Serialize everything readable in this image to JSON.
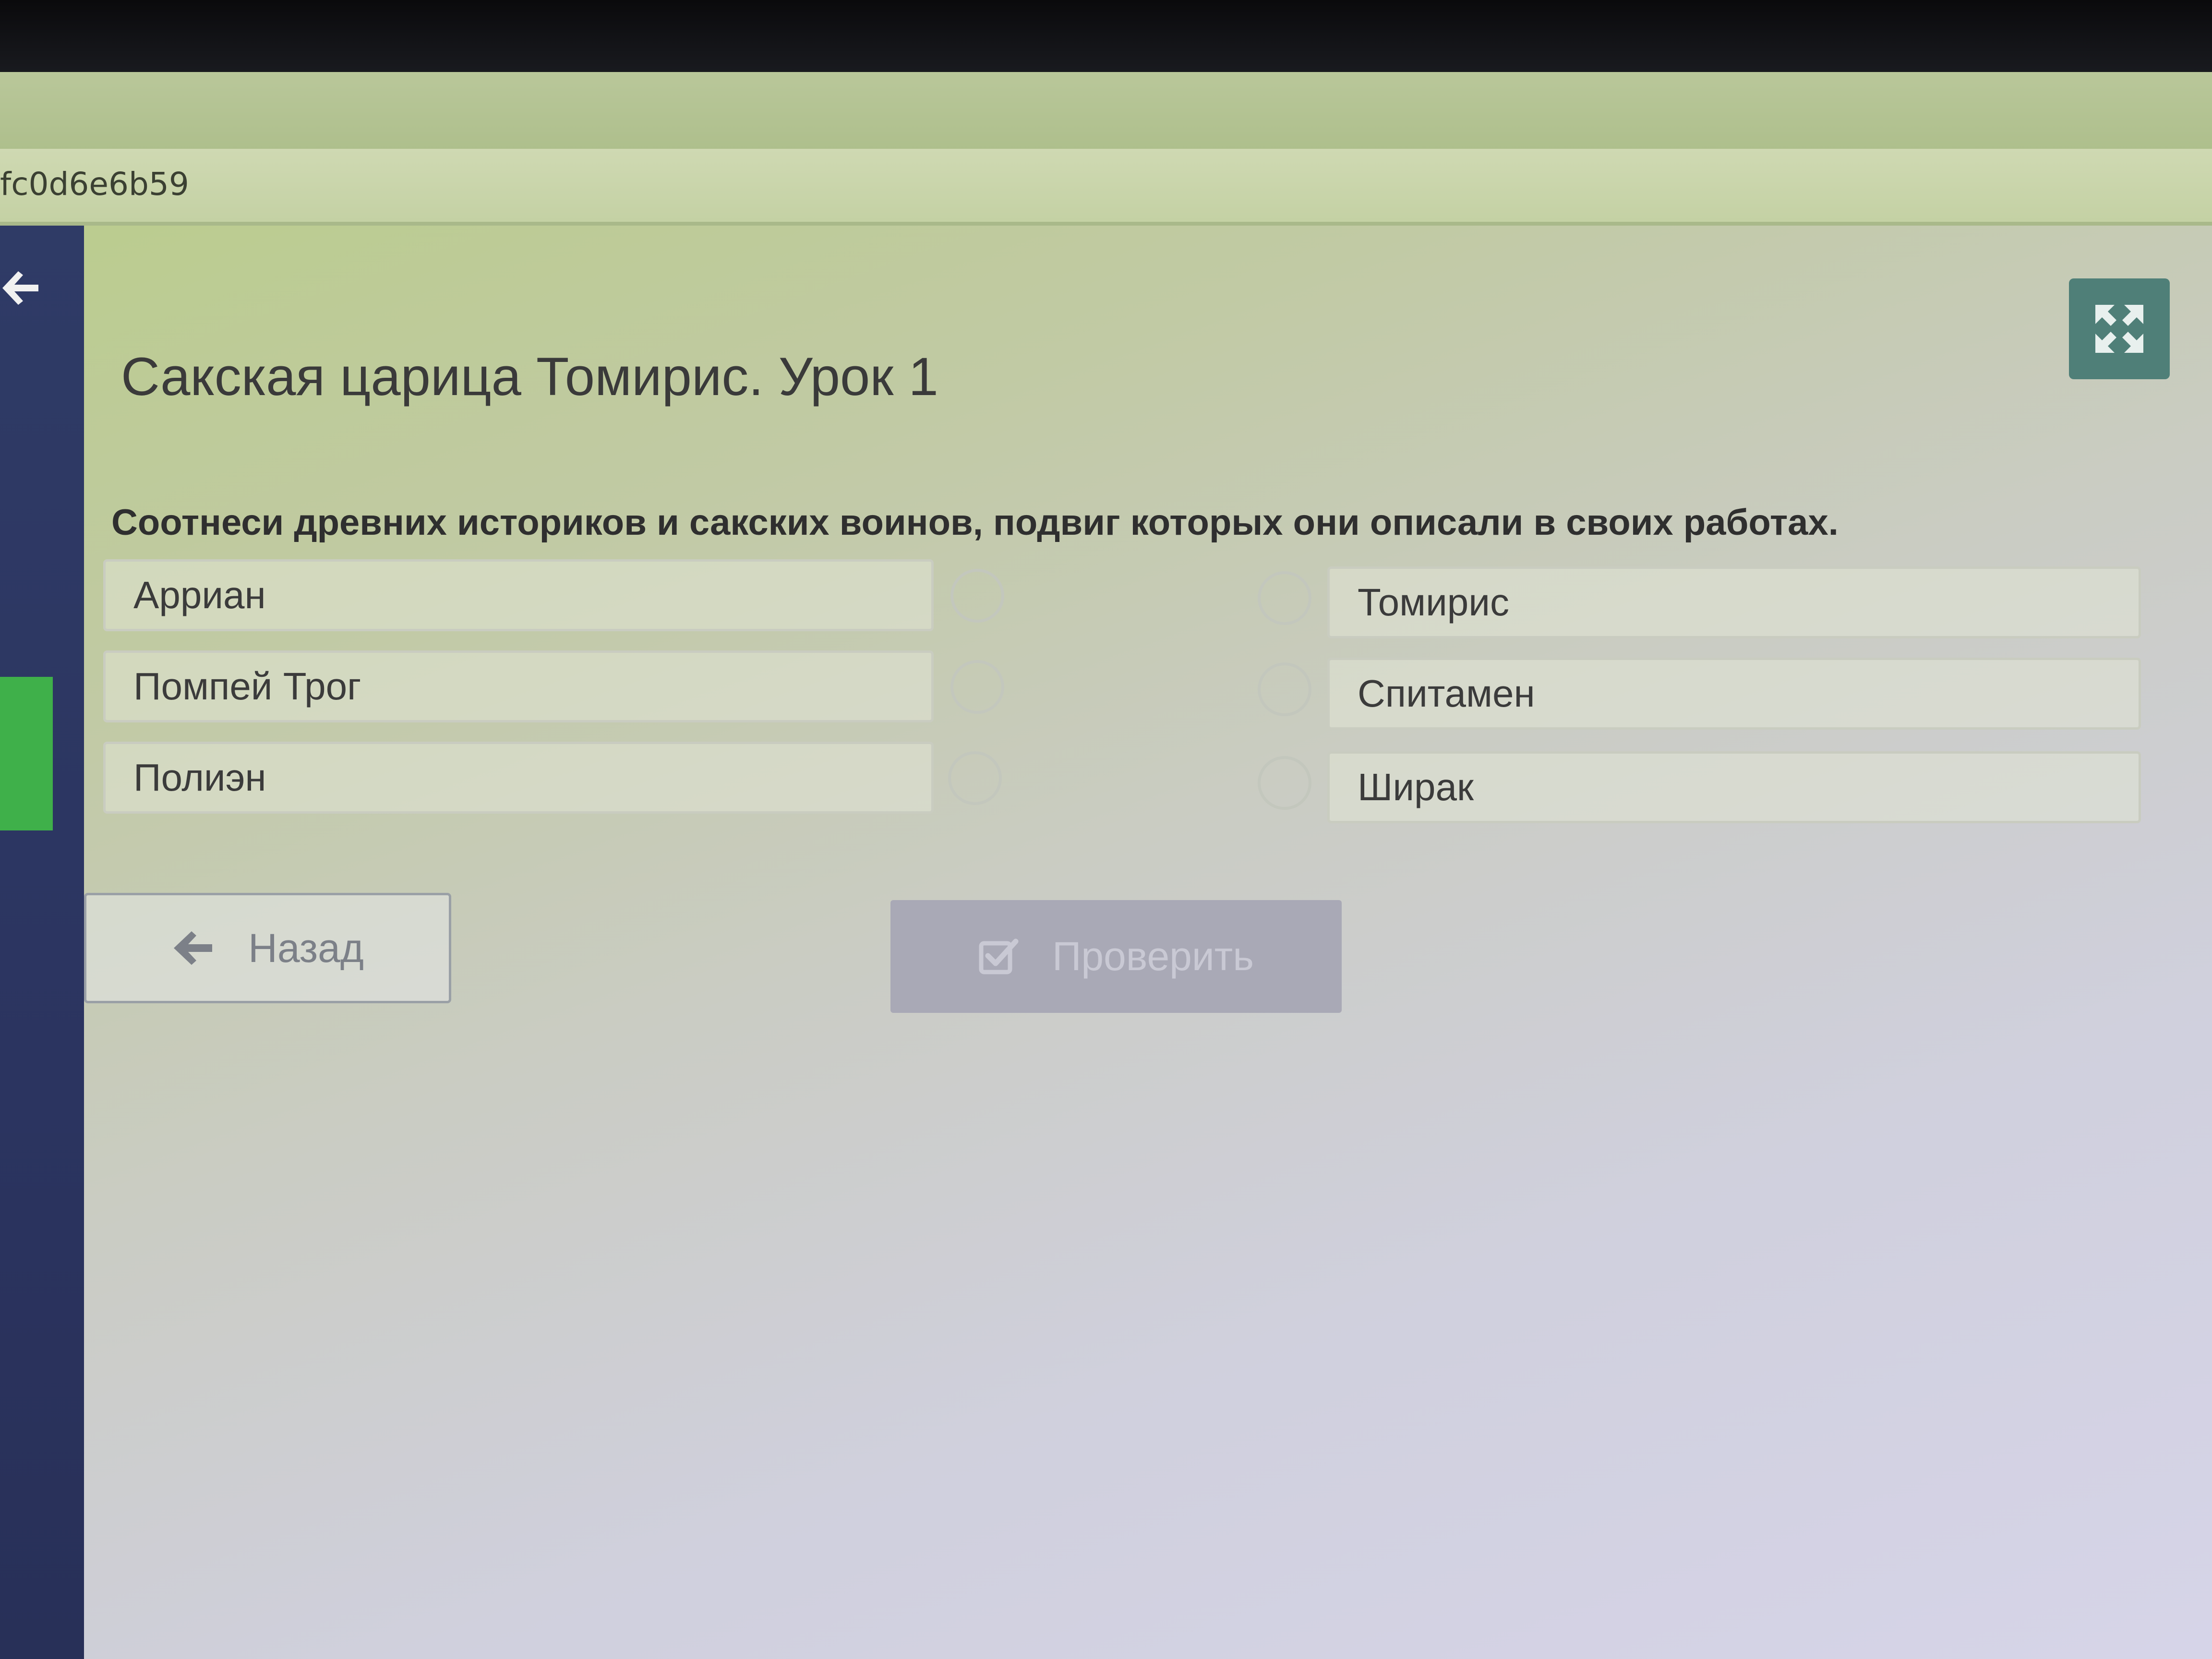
{
  "browser": {
    "url_fragment": "fc0d6e6b59"
  },
  "header": {
    "title": "Сакская царица Томирис. Урок 1"
  },
  "task": {
    "instruction": "Соотнеси древних историков и сакских воинов, подвиг которых они описали в своих работах.",
    "left_items": [
      {
        "label": "Арриан"
      },
      {
        "label": "Помпей Трог"
      },
      {
        "label": "Полиэн"
      }
    ],
    "right_items": [
      {
        "label": "Томирис"
      },
      {
        "label": "Спитамен"
      },
      {
        "label": "Ширак"
      }
    ]
  },
  "actions": {
    "back_label": "Назад",
    "check_label": "Проверить"
  },
  "icons": {
    "back": "arrow-left-icon",
    "expand": "expand-icon",
    "check": "checkbox-check-icon",
    "sidebar_back": "arrow-left-icon"
  },
  "colors": {
    "expand_button": "#4f7f78",
    "check_button_disabled": "#a9a9b6",
    "sidebar": "#2f3b66",
    "sidebar_active": "#3fb04a"
  }
}
